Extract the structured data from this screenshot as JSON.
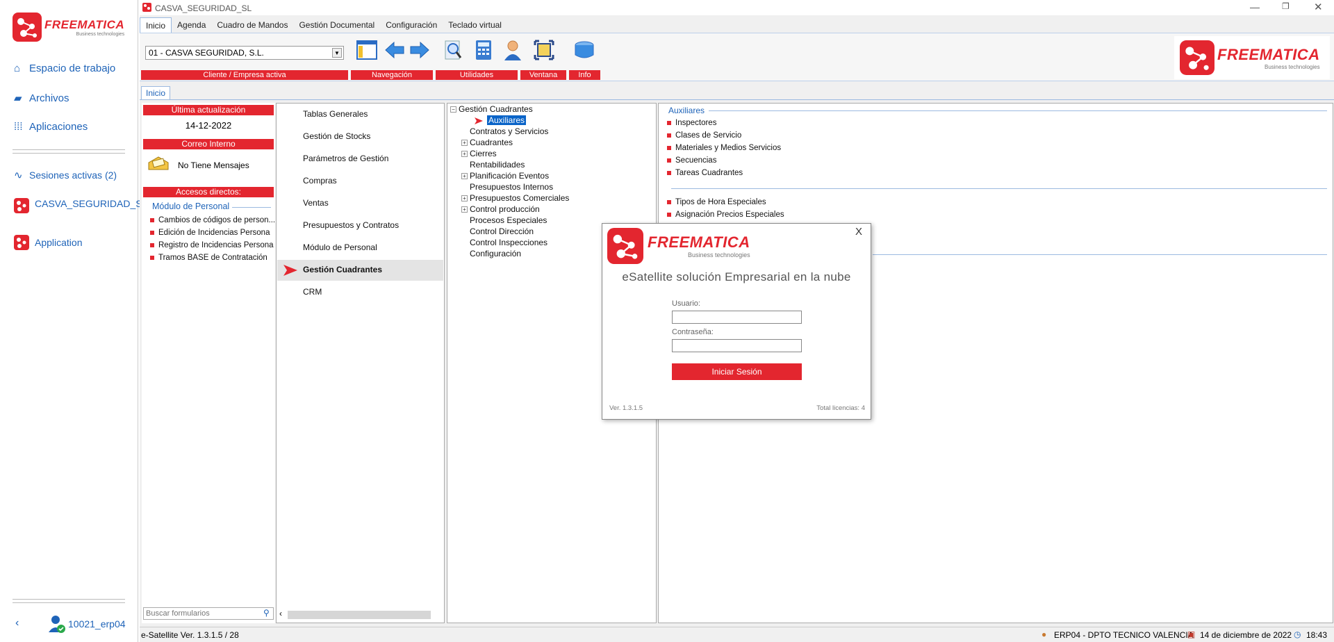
{
  "sidebar": {
    "brand": "FREEMATICA",
    "brand_sub": "Business technologies",
    "nav": [
      {
        "label": "Espacio de trabajo",
        "icon": "home-icon"
      },
      {
        "label": "Archivos",
        "icon": "folder-icon"
      },
      {
        "label": "Aplicaciones",
        "icon": "grid-icon"
      }
    ],
    "sessions_label": "Sesiones activas (2)",
    "sessions": [
      {
        "label": "CASVA_SEGURIDAD_SL"
      },
      {
        "label": "Application"
      }
    ],
    "user": "10021_erp04"
  },
  "window": {
    "title": "CASVA_SEGURIDAD_SL"
  },
  "menu": [
    "Inicio",
    "Agenda",
    "Cuadro de Mandos",
    "Gestión Documental",
    "Configuración",
    "Teclado virtual"
  ],
  "ribbon": {
    "company_value": "01 - CASVA SEGURIDAD, S.L.",
    "groups": [
      "Cliente / Empresa activa",
      "Navegación",
      "Utilidades",
      "Ventana",
      "Info"
    ]
  },
  "doc_tab": "Inicio",
  "left_panel": {
    "last_update_label": "Última actualización",
    "last_update_value": "14-12-2022",
    "mail_label": "Correo Interno",
    "mail_value": "No Tiene Mensajes",
    "shortcuts_label": "Accesos directos:",
    "shortcut_group": "Módulo de Personal",
    "shortcuts": [
      "Cambios de códigos de person...",
      "Edición de Incidencias Persona",
      "Registro de Incidencias Persona",
      "Tramos BASE de Contratación"
    ],
    "search_placeholder": "Buscar formularios"
  },
  "modules": [
    "Tablas Generales",
    "Gestión de Stocks",
    "Parámetros de Gestión",
    "Compras",
    "Ventas",
    "Presupuestos y Contratos",
    "Módulo de Personal",
    "Gestión Cuadrantes",
    "CRM"
  ],
  "tree": {
    "root": "Gestión Cuadrantes",
    "items": [
      {
        "label": "Auxiliares",
        "expander": ""
      },
      {
        "label": "Contratos y Servicios",
        "expander": ""
      },
      {
        "label": "Cuadrantes",
        "expander": "+"
      },
      {
        "label": "Cierres",
        "expander": "+"
      },
      {
        "label": "Rentabilidades",
        "expander": ""
      },
      {
        "label": "Planificación Eventos",
        "expander": "+"
      },
      {
        "label": "Presupuestos Internos",
        "expander": ""
      },
      {
        "label": "Presupuestos Comerciales",
        "expander": "+"
      },
      {
        "label": "Control producción",
        "expander": "+"
      },
      {
        "label": "Procesos Especiales",
        "expander": ""
      },
      {
        "label": "Control Dirección",
        "expander": ""
      },
      {
        "label": "Control Inspecciones",
        "expander": ""
      },
      {
        "label": "Configuración",
        "expander": ""
      }
    ]
  },
  "aux": {
    "title": "Auxiliares",
    "group1": [
      "Inspectores",
      "Clases de Servicio",
      "Materiales y Medios Servicios",
      "Secuencias",
      "Tareas Cuadrantes"
    ],
    "group2": [
      "Tipos de Hora Especiales",
      "Asignación Precios Especiales"
    ]
  },
  "login": {
    "brand": "FREEMATICA",
    "brand_sub": "Business technologies",
    "tagline": "eSatellite solución Empresarial en la nube",
    "user_label": "Usuario:",
    "pass_label": "Contraseña:",
    "button": "Iniciar Sesión",
    "version": "Ver. 1.3.1.5",
    "licenses": "Total licencias: 4",
    "close": "X"
  },
  "status": {
    "version": "e-Satellite Ver. 1.3.1.5 / 28",
    "user": "ERP04 - DPTO TECNICO VALENCIA",
    "date": "14 de diciembre de 2022",
    "time": "18:43"
  },
  "colors": {
    "brand_red": "#e3262f",
    "link_blue": "#1e63b8",
    "selection_blue": "#0a64c8"
  }
}
